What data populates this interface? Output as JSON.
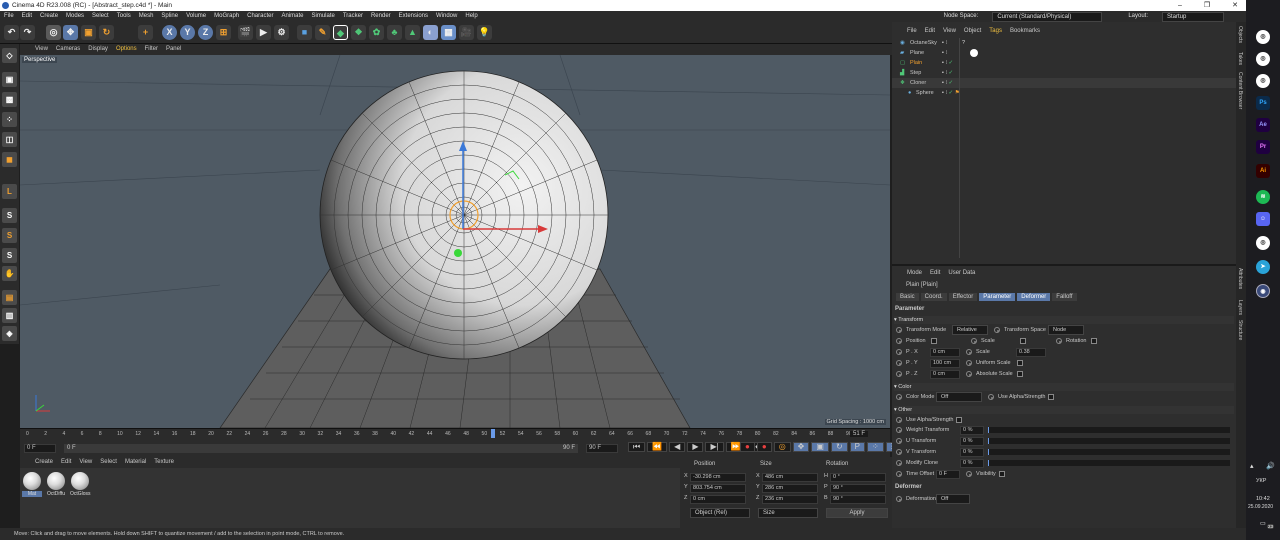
{
  "window": {
    "title": "Cinema 4D R23.008 (RC) - [Abstract_step.c4d *] - Main",
    "controls": [
      "–",
      "❐",
      "✕"
    ]
  },
  "menu": {
    "items": [
      "File",
      "Edit",
      "Create",
      "Modes",
      "Select",
      "Tools",
      "Mesh",
      "Spline",
      "Volume",
      "MoGraph",
      "Character",
      "Animate",
      "Simulate",
      "Tracker",
      "Render",
      "Extensions",
      "Window",
      "Help"
    ],
    "node_space_label": "Node Space:",
    "node_space_value": "Current (Standard/Physical)",
    "layout_label": "Layout:",
    "layout_value": "Startup"
  },
  "toolbar": {
    "icons": [
      "undo-icon",
      "redo-icon",
      "live-selection-icon",
      "move-icon",
      "scale-icon",
      "rotate-icon",
      "add-icon",
      "x-axis-icon",
      "y-axis-icon",
      "z-axis-icon",
      "coordinate-system-icon",
      "render-view-icon",
      "render-picture-queue-icon",
      "edit-render-settings-icon",
      "cube-icon",
      "pen-icon",
      "subdivision-icon",
      "cloner-icon",
      "deformer-icon",
      "field-icon",
      "environment-icon",
      "scene-icon",
      "camera-icon",
      "light-icon"
    ],
    "axis_labels": [
      "X",
      "Y",
      "Z"
    ]
  },
  "viewport": {
    "menu": [
      "View",
      "Cameras",
      "Display",
      "Options",
      "Filter",
      "Panel"
    ],
    "label": "Perspective",
    "grid_spacing": "Grid Spacing : 1000 cm"
  },
  "timeline": {
    "ticks": [
      "0",
      "2",
      "4",
      "6",
      "8",
      "10",
      "12",
      "14",
      "16",
      "18",
      "20",
      "22",
      "24",
      "26",
      "28",
      "30",
      "32",
      "34",
      "36",
      "38",
      "40",
      "42",
      "44",
      "46",
      "48",
      "50",
      "52",
      "54",
      "56",
      "58",
      "60",
      "62",
      "64",
      "66",
      "68",
      "70",
      "72",
      "74",
      "76",
      "78",
      "80",
      "82",
      "84",
      "86",
      "88",
      "90"
    ],
    "current_frame_label": "51 F",
    "start": "0 F",
    "preview_start": "0 F",
    "preview_end": "90 F",
    "end": "90 F",
    "playhead_fraction": 0.567
  },
  "materials": {
    "menu": [
      "Create",
      "Edit",
      "View",
      "Select",
      "Material",
      "Texture"
    ],
    "items": [
      "Mat",
      "OctDiffu",
      "OctGloss"
    ]
  },
  "coordinates": {
    "headers": [
      "Position",
      "Size",
      "Rotation"
    ],
    "rows": [
      {
        "axis": "X",
        "pos": "-30.298 cm",
        "size_axis": "X",
        "size": "486 cm",
        "rot_axis": "H",
        "rot": "0 °"
      },
      {
        "axis": "Y",
        "pos": "803.754 cm",
        "size_axis": "Y",
        "size": "286 cm",
        "rot_axis": "P",
        "rot": "90 °"
      },
      {
        "axis": "Z",
        "pos": "0 cm",
        "size_axis": "Z",
        "size": "236 cm",
        "rot_axis": "B",
        "rot": "90 °"
      }
    ],
    "mode_dropdown": "Object (Rel)",
    "size_dropdown": "Size",
    "apply": "Apply"
  },
  "objects": {
    "menu": [
      "File",
      "Edit",
      "View",
      "Object",
      "Tags",
      "Bookmarks"
    ],
    "items": [
      {
        "name": "OctaneSky",
        "indent": 0
      },
      {
        "name": "Plane",
        "indent": 0
      },
      {
        "name": "Plain",
        "indent": 0,
        "selected": true
      },
      {
        "name": "Step",
        "indent": 0
      },
      {
        "name": "Cloner",
        "indent": 0
      },
      {
        "name": "Sphere",
        "indent": 1
      }
    ]
  },
  "attributes": {
    "menu": [
      "Mode",
      "Edit",
      "User Data"
    ],
    "object_title": "Plain [Plain]",
    "tabs": [
      "Basic",
      "Coord.",
      "Effector",
      "Parameter",
      "Deformer",
      "Falloff"
    ],
    "active_tabs": [
      "Parameter",
      "Deformer"
    ],
    "parameter_heading": "Parameter",
    "transform_heading": "Transform",
    "transform_mode_label": "Transform Mode",
    "transform_mode_value": "Relative",
    "transform_space_label": "Transform Space",
    "transform_space_value": "Node",
    "position_label": "Position",
    "scale_label": "Scale",
    "rotation_label": "Rotation",
    "px_label": "P . X",
    "px": "0 cm",
    "py_label": "P . Y",
    "py": "100 cm",
    "pz_label": "P . Z",
    "pz": "0 cm",
    "scale_value_label": "Scale",
    "scale_value": "0.38",
    "uniform_scale_label": "Uniform Scale",
    "absolute_scale_label": "Absolute Scale",
    "color_heading": "Color",
    "color_mode_label": "Color Mode",
    "color_mode_value": "Off",
    "use_alpha_label": "Use Alpha/Strength",
    "other_heading": "Other",
    "use_alpha_strength_label": "Use Alpha/Strength",
    "weight_transform_label": "Weight Transform",
    "weight_transform": "0 %",
    "u_transform_label": "U Transform",
    "u_transform": "0 %",
    "v_transform_label": "V Transform",
    "v_transform": "0 %",
    "modify_clone_label": "Modify Clone",
    "modify_clone": "0 %",
    "time_offset_label": "Time Offset",
    "time_offset": "0 F",
    "visibility_label": "Visibility",
    "deformer_heading": "Deformer",
    "deformation_label": "Deformation",
    "deformation_value": "Off"
  },
  "side_tabs": [
    "Objects",
    "Takes",
    "Content Browser",
    "Attributes",
    "Layers",
    "Structure"
  ],
  "status": "Move: Click and drag to move elements. Hold down SHIFT to quantize movement / add to the selection in point mode, CTRL to remove.",
  "taskbar": {
    "apps": [
      "chrome-icon",
      "chrome-icon",
      "chrome-icon",
      "photoshop-icon",
      "after-effects-icon",
      "premiere-icon",
      "illustrator-icon",
      "spotify-icon",
      "discord-icon",
      "chrome-icon",
      "telegram-icon",
      "cinema4d-icon"
    ],
    "app_labels": [
      "Ps",
      "Ae",
      "Pr",
      "Ai"
    ],
    "lang": "УКР",
    "time": "10:42",
    "date": "25.09.2020",
    "notif_count": "23"
  }
}
